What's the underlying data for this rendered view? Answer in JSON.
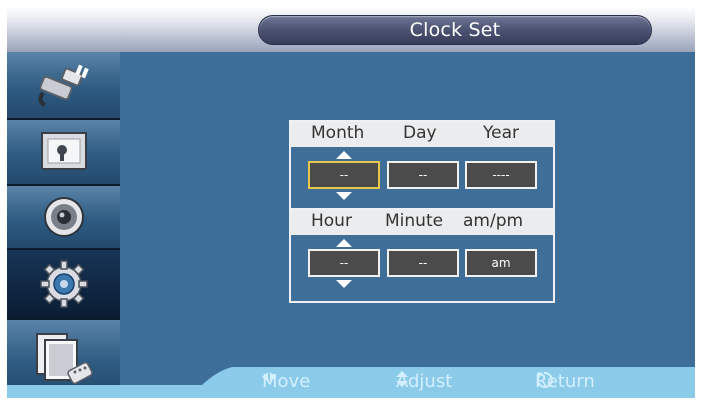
{
  "title": "Clock Set",
  "sidebar": {
    "items": [
      {
        "icon": "plug-icon",
        "active": false
      },
      {
        "icon": "picture-frame-icon",
        "active": false
      },
      {
        "icon": "speaker-icon",
        "active": false
      },
      {
        "icon": "gear-icon",
        "active": true
      },
      {
        "icon": "screens-remote-icon",
        "active": false
      }
    ]
  },
  "dialog": {
    "date_headers": {
      "month": "Month",
      "day": "Day",
      "year": "Year"
    },
    "date_values": {
      "month": "--",
      "day": "--",
      "year": "----"
    },
    "time_headers": {
      "hour": "Hour",
      "minute": "Minute",
      "ampm": "am/pm"
    },
    "time_values": {
      "hour": "--",
      "minute": "--",
      "ampm": "am"
    }
  },
  "hints": {
    "move": "Move",
    "adjust": "Adjust",
    "return": "Return"
  },
  "colors": {
    "background": "#3d6d99",
    "focus_border": "#e9c74a",
    "hint_text": "#d2f0ff"
  }
}
